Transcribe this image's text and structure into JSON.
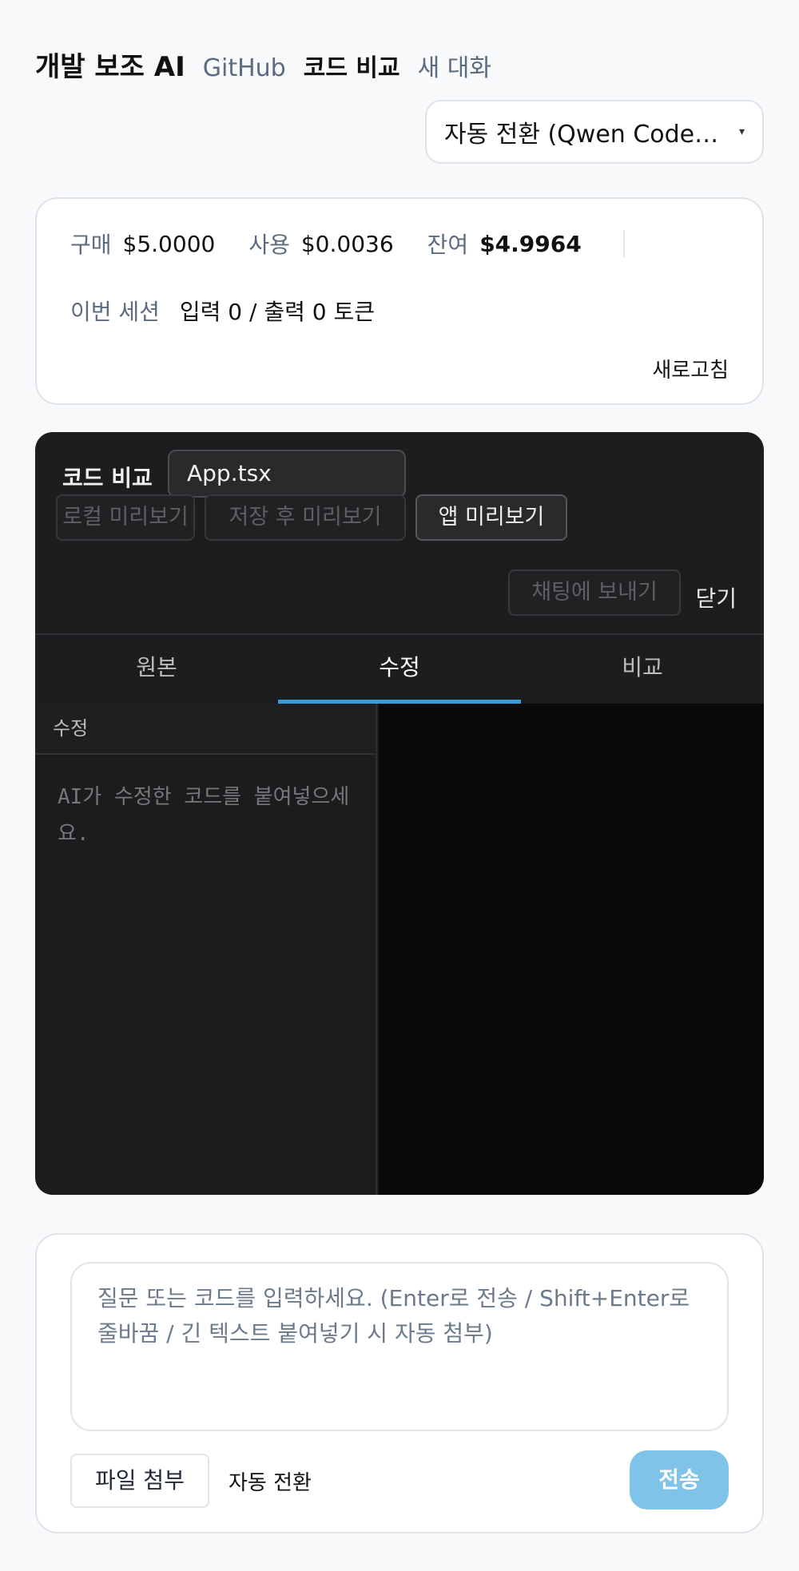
{
  "nav": {
    "brand": "개발 보조 AI",
    "links": [
      "GitHub",
      "코드 비교",
      "새 대화"
    ]
  },
  "model_select": {
    "value": "자동 전환 (Qwen Code…",
    "caret": "▾"
  },
  "usage": {
    "purchase_label": "구매",
    "purchase_value": "$5.0000",
    "used_label": "사용",
    "used_value": "$0.0036",
    "balance_label": "잔여",
    "balance_value": "$4.9964",
    "session_label": "이번 세션",
    "session_value": "입력 0 / 출력 0 토큰",
    "refresh_label": "새로고침"
  },
  "code_compare": {
    "title": "코드 비교",
    "file_name": "App.tsx",
    "buttons": {
      "local_preview": "로컬 미리보기",
      "save_preview": "저장 후 미리보기",
      "app_preview": "앱 미리보기",
      "send_to_chat": "채팅에 보내기",
      "close": "닫기"
    },
    "tabs": [
      "원본",
      "수정",
      "비교"
    ],
    "active_tab": "수정",
    "pane_header": "수정",
    "editor_placeholder": "AI가 수정한 코드를 붙여넣으세요."
  },
  "composer": {
    "placeholder": "질문 또는 코드를 입력하세요. (Enter로 전송 / Shift+Enter로 줄바꿈 / 긴 텍스트 붙여넣기 시 자동 첨부)",
    "attach_label": "파일 첨부",
    "mode_label": "자동 전환",
    "send_label": "전송"
  },
  "colors": {
    "accent": "#3a9bd6",
    "send_button": "#7fc4e8",
    "panel_bg": "#1d1d1f",
    "page_bg": "#f7f9fb"
  }
}
